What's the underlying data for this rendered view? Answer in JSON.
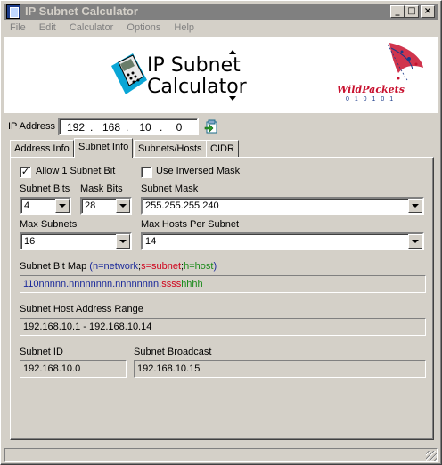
{
  "window": {
    "title": "IP Subnet Calculator",
    "minimize": "_",
    "maximize": "□",
    "close": "×"
  },
  "menu": [
    "File",
    "Edit",
    "Calculator",
    "Options",
    "Help"
  ],
  "banner": {
    "title_line1": "IP Subnet",
    "title_line2": "Calculator",
    "logo_text": "WildPackets",
    "logo_sub": "0 1 0 1 0 1"
  },
  "ip": {
    "label": "IP Address",
    "octets": [
      "192",
      "168",
      "10",
      "0"
    ]
  },
  "tabs": [
    "Address Info",
    "Subnet Info",
    "Subnets/Hosts",
    "CIDR"
  ],
  "active_tab": "Subnet Info",
  "subnet_info": {
    "allow_1_bit_label": "Allow 1 Subnet Bit",
    "allow_1_bit_checked": true,
    "inversed_mask_label": "Use Inversed Mask",
    "inversed_mask_checked": false,
    "subnet_bits_label": "Subnet Bits",
    "subnet_bits_value": "4",
    "mask_bits_label": "Mask Bits",
    "mask_bits_value": "28",
    "subnet_mask_label": "Subnet Mask",
    "subnet_mask_value": "255.255.255.240",
    "max_subnets_label": "Max Subnets",
    "max_subnets_value": "16",
    "max_hosts_label": "Max Hosts Per Subnet",
    "max_hosts_value": "14",
    "bitmap_label": "Subnet Bit Map",
    "bitmap_legend": {
      "open": "(",
      "n": "n=network",
      "sep1": ";",
      "s": "s=subnet",
      "sep2": ";",
      "h": "h=host",
      "close": ")"
    },
    "bitmap_value": {
      "network": "110nnnnn.nnnnnnnn.nnnnnnnn.",
      "subnet": "ssss",
      "host": "hhhh"
    },
    "host_range_label": "Subnet Host Address Range",
    "host_range_value": "192.168.10.1 - 192.168.10.14",
    "subnet_id_label": "Subnet ID",
    "subnet_id_value": "192.168.10.0",
    "broadcast_label": "Subnet Broadcast",
    "broadcast_value": "192.168.10.15"
  },
  "colors": {
    "network": "#1b2a9a",
    "subnet": "#d0021b",
    "host": "#1a8a1a",
    "face": "#d4d0c8",
    "title_inactive": "#808080"
  }
}
